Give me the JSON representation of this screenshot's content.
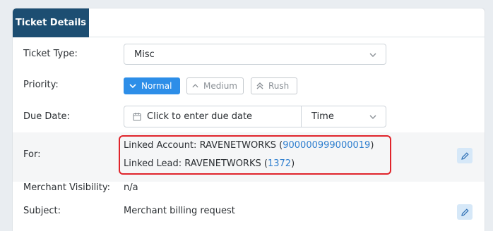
{
  "tab": {
    "title": "Ticket Details"
  },
  "fields": {
    "ticket_type": {
      "label": "Ticket Type:",
      "value": "Misc"
    },
    "priority": {
      "label": "Priority:",
      "options": [
        {
          "label": "Normal",
          "icon": "chevron-down-icon",
          "selected": true
        },
        {
          "label": "Medium",
          "icon": "chevron-up-icon",
          "selected": false
        },
        {
          "label": "Rush",
          "icon": "double-chevron-up-icon",
          "selected": false
        }
      ]
    },
    "due_date": {
      "label": "Due Date:",
      "placeholder": "Click to enter due date",
      "time_placeholder": "Time"
    },
    "for": {
      "label": "For:",
      "linked_account_label": "Linked Account:",
      "linked_account_name": "RAVENETWORKS",
      "linked_account_id": "900000999000019",
      "linked_lead_label": "Linked Lead:",
      "linked_lead_name": "RAVENETWORKS",
      "linked_lead_id": "1372"
    },
    "merchant_visibility": {
      "label": "Merchant Visibility:",
      "value": "n/a"
    },
    "subject": {
      "label": "Subject:",
      "value": "Merchant billing request"
    }
  },
  "colors": {
    "tab_bg": "#1d4e72",
    "primary": "#2d8ee8",
    "link": "#2f7fcf",
    "highlight_border": "#e0242b",
    "edit_button_bg": "#d6e8f8"
  }
}
